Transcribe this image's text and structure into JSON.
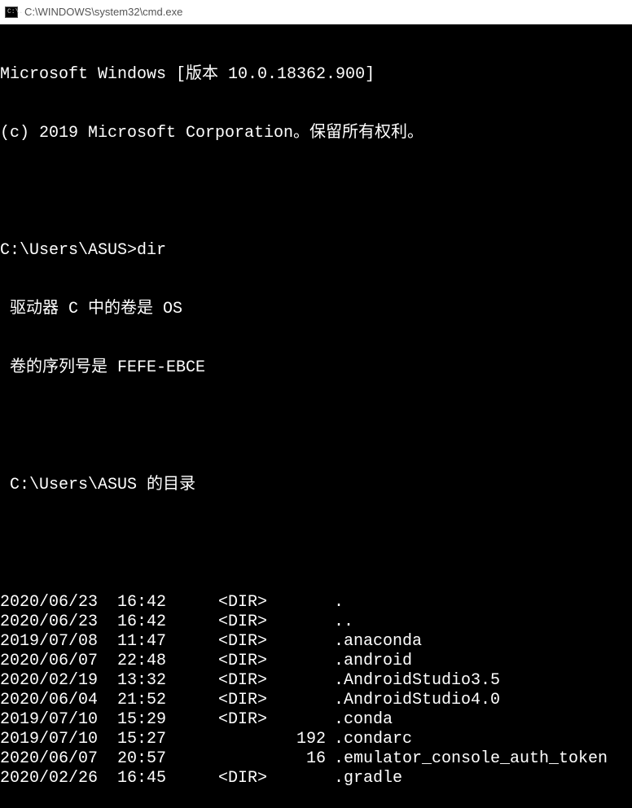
{
  "titlebar": {
    "icon_text": "C:\\.",
    "title": "C:\\WINDOWS\\system32\\cmd.exe"
  },
  "terminal": {
    "header1": "Microsoft Windows [版本 10.0.18362.900]",
    "header2": "(c) 2019 Microsoft Corporation。保留所有权利。",
    "prompt": "C:\\Users\\ASUS>",
    "command": "dir",
    "volume_line": " 驱动器 C 中的卷是 OS",
    "serial_line": " 卷的序列号是 FEFE-EBCE",
    "dir_of_line": " C:\\Users\\ASUS 的目录",
    "dir_label": "<DIR>",
    "entries": [
      {
        "date": "2020/06/23",
        "time": "16:42",
        "type": "dir",
        "size": "",
        "name": "."
      },
      {
        "date": "2020/06/23",
        "time": "16:42",
        "type": "dir",
        "size": "",
        "name": ".."
      },
      {
        "date": "2019/07/08",
        "time": "11:47",
        "type": "dir",
        "size": "",
        "name": ".anaconda"
      },
      {
        "date": "2020/06/07",
        "time": "22:48",
        "type": "dir",
        "size": "",
        "name": ".android"
      },
      {
        "date": "2020/02/19",
        "time": "13:32",
        "type": "dir",
        "size": "",
        "name": ".AndroidStudio3.5"
      },
      {
        "date": "2020/06/04",
        "time": "21:52",
        "type": "dir",
        "size": "",
        "name": ".AndroidStudio4.0"
      },
      {
        "date": "2019/07/10",
        "time": "15:29",
        "type": "dir",
        "size": "",
        "name": ".conda"
      },
      {
        "date": "2019/07/10",
        "time": "15:27",
        "type": "file",
        "size": "192",
        "name": ".condarc"
      },
      {
        "date": "2020/06/07",
        "time": "20:57",
        "type": "file",
        "size": "16",
        "name": ".emulator_console_auth_token"
      },
      {
        "date": "2020/02/26",
        "time": "16:45",
        "type": "dir",
        "size": "",
        "name": ".gradle"
      }
    ]
  }
}
